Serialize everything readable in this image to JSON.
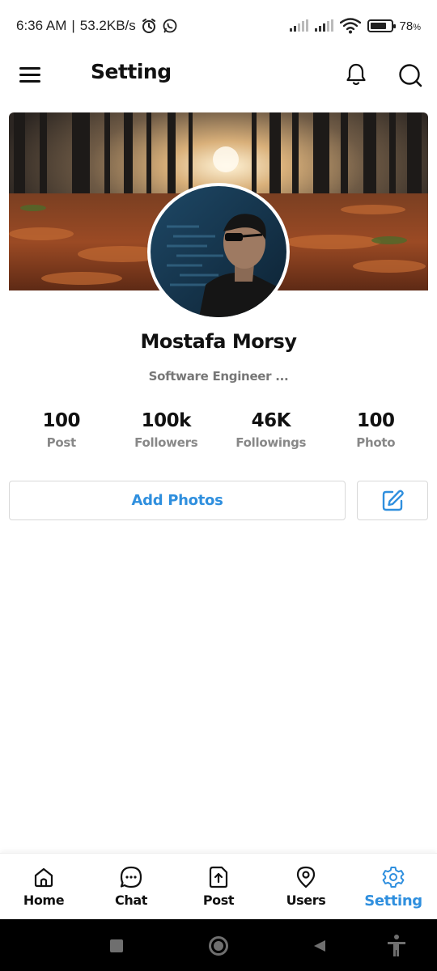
{
  "status_bar": {
    "time": "6:36 AM",
    "separator": "|",
    "net_speed": "53.2KB/s",
    "battery": "78",
    "battery_unit": "%",
    "battery_level": 0.78,
    "icons": [
      "alarm-icon",
      "whatsapp-icon",
      "signal-icon",
      "signal-icon",
      "wifi-icon",
      "battery-icon"
    ]
  },
  "app_bar": {
    "title": "Setting",
    "icons": [
      "menu-icon",
      "bell-icon",
      "search-icon"
    ]
  },
  "profile": {
    "name": "Mostafa Morsy",
    "bio": "Software Engineer ...",
    "stats": [
      {
        "value": "100",
        "label": "Post"
      },
      {
        "value": "100k",
        "label": "Followers"
      },
      {
        "value": "46K",
        "label": "Followings"
      },
      {
        "value": "100",
        "label": "Photo"
      }
    ]
  },
  "actions": {
    "add_photos_label": "Add Photos",
    "edit_icon": "edit-icon"
  },
  "bottom_nav": {
    "items": [
      {
        "label": "Home",
        "icon": "home-icon"
      },
      {
        "label": "Chat",
        "icon": "chat-icon"
      },
      {
        "label": "Post",
        "icon": "upload-icon"
      },
      {
        "label": "Users",
        "icon": "location-icon"
      },
      {
        "label": "Setting",
        "icon": "gear-icon"
      }
    ],
    "active": "Setting"
  },
  "system_nav": {
    "icons": [
      "recents-icon",
      "home-circle-icon",
      "back-icon",
      "accessibility-icon"
    ]
  },
  "colors": {
    "accent": "#2f8fde",
    "text": "#111111",
    "muted": "#888888",
    "system_bar": "#000000"
  }
}
